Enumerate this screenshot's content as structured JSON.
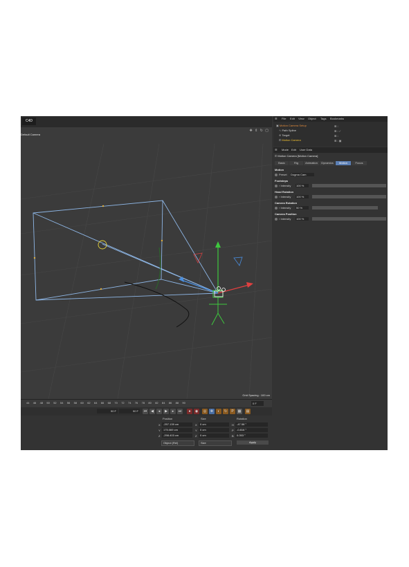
{
  "viewport": {
    "camera_label": "Default Camera",
    "grid_spacing": "Grid Spacing : 100 cm",
    "nav_icons": [
      "move-icon",
      "zoom-icon",
      "rotate-icon",
      "maximize-icon"
    ]
  },
  "timeline": {
    "ticks": [
      "44",
      "46",
      "48",
      "50",
      "52",
      "54",
      "56",
      "58",
      "60",
      "62",
      "64",
      "66",
      "68",
      "70",
      "72",
      "74",
      "76",
      "78",
      "80",
      "82",
      "84",
      "86",
      "88",
      "90"
    ],
    "current_frame": "0 F",
    "start_field": "90 F",
    "end_field": "90 F"
  },
  "coordinates": {
    "headers": {
      "position": "Position",
      "size": "Size",
      "rotation": "Rotation"
    },
    "rows": [
      {
        "axis": "X",
        "pos": "-257.139 cm",
        "size_axis": "X",
        "size": "0 cm",
        "rot_axis": "H",
        "rot": "-47.58 °"
      },
      {
        "axis": "Y",
        "pos": "175.069 cm",
        "size_axis": "Y",
        "size": "0 cm",
        "rot_axis": "P",
        "rot": "-0.816 °"
      },
      {
        "axis": "Z",
        "pos": "-298.403 cm",
        "size_axis": "Z",
        "size": "0 cm",
        "rot_axis": "B",
        "rot": "0.053 °"
      }
    ],
    "mode_dropdown": "Object (Rel)",
    "size_dropdown": "Size",
    "apply_label": "Apply"
  },
  "object_manager": {
    "menu": [
      "File",
      "Edit",
      "View",
      "Object",
      "Tags",
      "Bookmarks"
    ],
    "objects": [
      {
        "name": "Motion Camera Setup",
        "color": "#e08a3c"
      },
      {
        "name": "Path Spline",
        "color": "#d8d8d8"
      },
      {
        "name": "Target",
        "color": "#d8d8d8"
      },
      {
        "name": "Motion Camera",
        "color": "#f0c030"
      }
    ]
  },
  "attributes": {
    "menu": [
      "Mode",
      "Edit",
      "User Data"
    ],
    "title": "Motion Camera [Motion Camera]",
    "tabs": [
      "Basic",
      "Rig",
      "Animation",
      "Dynamics",
      "Motion",
      "Focus"
    ],
    "active_tab": "Motion",
    "sections": [
      {
        "title": "Motion",
        "params": [
          {
            "label": "Preset",
            "value": "Dogma Cam"
          }
        ]
      },
      {
        "title": "Footsteps",
        "params": [
          {
            "label": "Intensity",
            "value": "100 %"
          }
        ]
      },
      {
        "title": "Head Rotation",
        "params": [
          {
            "label": "Intensity",
            "value": "100 %"
          }
        ]
      },
      {
        "title": "Camera Rotation",
        "params": [
          {
            "label": "Intensity",
            "value": "50 %"
          }
        ]
      },
      {
        "title": "Camera Position",
        "params": [
          {
            "label": "Intensity",
            "value": "100 %"
          }
        ]
      }
    ]
  }
}
